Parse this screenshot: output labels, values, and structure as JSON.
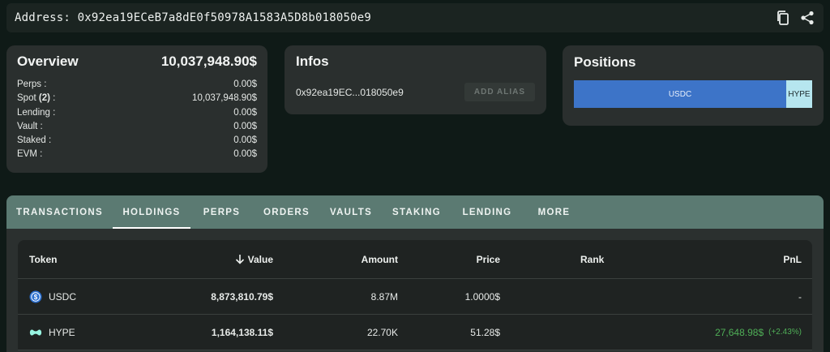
{
  "address_bar": {
    "text": "Address: 0x92ea19ECeB7a8dE0f50978A1583A5D8b018050e9",
    "icons": [
      "copy-icon",
      "share-icon"
    ]
  },
  "overview": {
    "title": "Overview",
    "total": "10,037,948.90$",
    "rows": [
      {
        "label": "Perps :",
        "value": "0.00$"
      },
      {
        "label_prefix": "Spot ",
        "label_count": "(2)",
        "label_suffix": " :",
        "value": "10,037,948.90$"
      },
      {
        "label": "Lending :",
        "value": "0.00$"
      },
      {
        "label": "Vault :",
        "value": "0.00$"
      },
      {
        "label": "Staked :",
        "value": "0.00$"
      },
      {
        "label": "EVM :",
        "value": "0.00$"
      }
    ]
  },
  "infos": {
    "title": "Infos",
    "short_address": "0x92ea19EC...018050e9",
    "alias_button": "ADD ALIAS"
  },
  "positions": {
    "title": "Positions",
    "segments": [
      {
        "label": "USDC",
        "share": 0.891,
        "color": "#3d74c8"
      },
      {
        "label": "HYPE",
        "share": 0.109,
        "color": "#b6e6ef"
      }
    ]
  },
  "tabs": [
    "TRANSACTIONS",
    "HOLDINGS",
    "PERPS",
    "ORDERS",
    "VAULTS",
    "STAKING",
    "LENDING",
    "MORE"
  ],
  "active_tab": "HOLDINGS",
  "table": {
    "headers": {
      "token": "Token",
      "value": "Value",
      "amount": "Amount",
      "price": "Price",
      "rank": "Rank",
      "pnl": "PnL"
    },
    "sort_icon": "arrow-down-icon",
    "rows": [
      {
        "icon": "usdc-icon",
        "token": "USDC",
        "value": "8,873,810.79$",
        "amount": "8.87M",
        "price": "1.0000$",
        "rank": "",
        "pnl": "-",
        "pnl_pct": ""
      },
      {
        "icon": "hype-icon",
        "token": "HYPE",
        "value": "1,164,138.11$",
        "amount": "22.70K",
        "price": "51.28$",
        "rank": "",
        "pnl": "27,648.98$",
        "pnl_pct": "(+2.43%)"
      }
    ]
  },
  "colors": {
    "background": "#0f1a17",
    "card": "#2a2f2e",
    "tabs_bar": "#5b7a72",
    "pnl_positive": "#4fae57"
  }
}
